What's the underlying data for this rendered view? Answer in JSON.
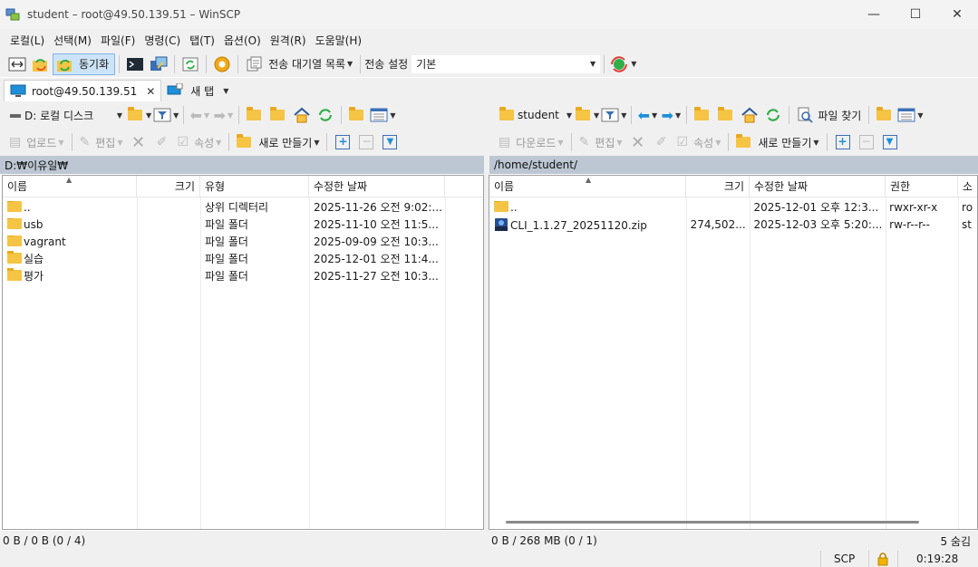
{
  "window": {
    "title": "student – root@49.50.139.51 – WinSCP",
    "minimize": "—",
    "maximize": "☐",
    "close": "✕"
  },
  "menu": [
    "로컬(L)",
    "선택(M)",
    "파일(F)",
    "명령(C)",
    "탭(T)",
    "옵션(O)",
    "원격(R)",
    "도움말(H)"
  ],
  "toolbar": {
    "sync_label": "동기화",
    "queue_label": "전송 대기열 목록",
    "transfer_settings_label": "전송 설정",
    "transfer_preset": "기본"
  },
  "tabs": {
    "session_label": "root@49.50.139.51",
    "new_tab_label": "새 탭"
  },
  "left": {
    "drive": "D: 로컬 디스크",
    "upload": "업로드",
    "edit": "편집",
    "properties": "속성",
    "new": "새로 만들기",
    "path": "D:₩이유일₩",
    "columns": [
      "이름",
      "크기",
      "유형",
      "수정한 날짜"
    ],
    "rows": [
      {
        "name": "..",
        "size": "",
        "type": "상위 디렉터리",
        "modified": "2025-11-26 오전 9:02:..."
      },
      {
        "name": "usb",
        "size": "",
        "type": "파일 폴더",
        "modified": "2025-11-10 오전 11:5..."
      },
      {
        "name": "vagrant",
        "size": "",
        "type": "파일 폴더",
        "modified": "2025-09-09 오전 10:3..."
      },
      {
        "name": "실습",
        "size": "",
        "type": "파일 폴더",
        "modified": "2025-12-01 오전 11:4..."
      },
      {
        "name": "평가",
        "size": "",
        "type": "파일 폴더",
        "modified": "2025-11-27 오전 10:3..."
      }
    ],
    "status": "0 B / 0 B (0 / 4)"
  },
  "right": {
    "dir": "student",
    "find_files": "파일 찾기",
    "download": "다운로드",
    "edit": "편집",
    "properties": "속성",
    "new": "새로 만들기",
    "path": "/home/student/",
    "columns": [
      "이름",
      "크기",
      "수정한 날짜",
      "권한",
      "소"
    ],
    "rows": [
      {
        "name": "..",
        "size": "",
        "modified": "2025-12-01 오후 12:3...",
        "rights": "rwxr-xr-x",
        "owner": "ro"
      },
      {
        "name": "CLI_1.1.27_20251120.zip",
        "size": "274,502...",
        "modified": "2025-12-03 오후 5:20:...",
        "rights": "rw-r--r--",
        "owner": "st"
      }
    ],
    "status": "0 B / 268 MB (0 / 1)",
    "hidden": "5 숨김"
  },
  "bottom": {
    "protocol": "SCP",
    "elapsed": "0:19:28"
  },
  "colors": {
    "path_bg": "#bcc7d3",
    "sync_bg": "#cce4f7",
    "folder": "#f5c445",
    "accent_blue": "#1e8fd8",
    "accent_green": "#2fae4a"
  }
}
